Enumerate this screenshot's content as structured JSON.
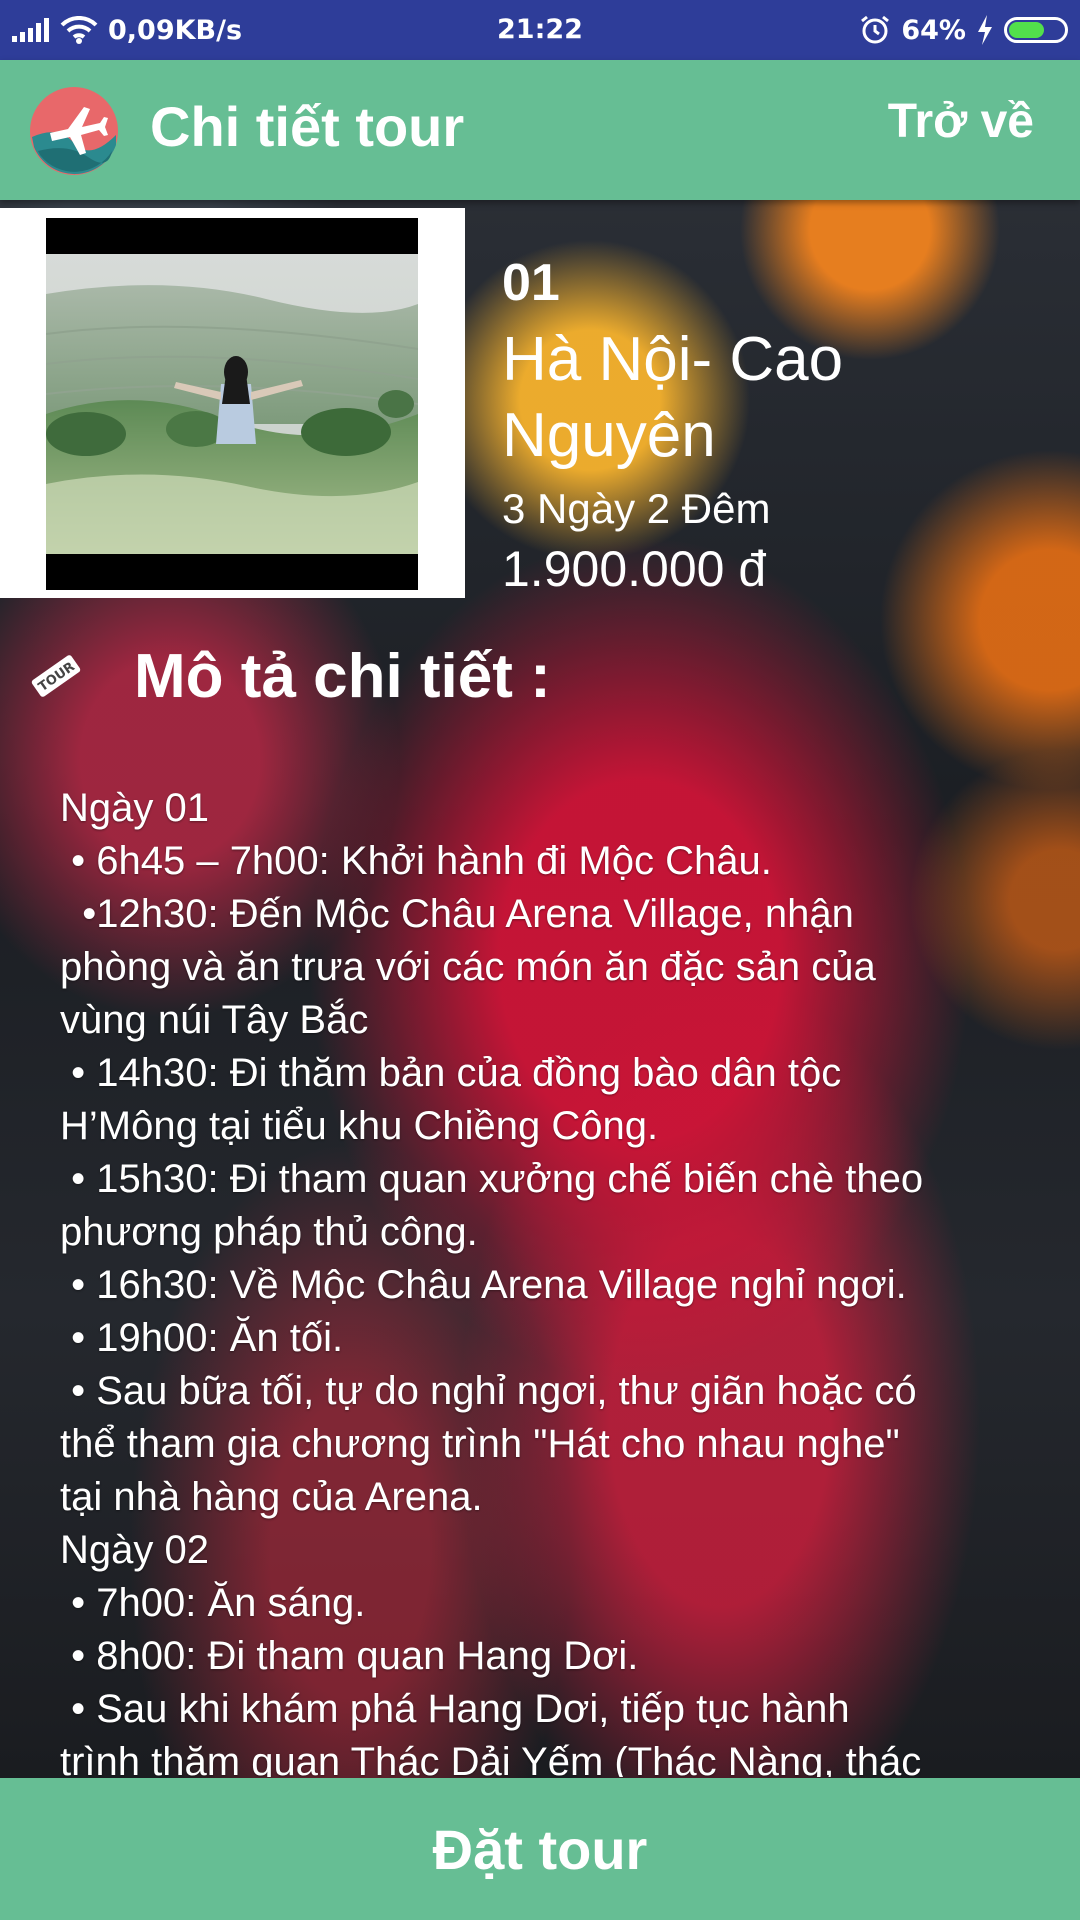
{
  "status_bar": {
    "network_speed": "0,09KB/s",
    "time": "21:22",
    "battery_percent": "64%",
    "battery_level": 0.64,
    "icons": [
      "signal-icon",
      "wifi-icon",
      "alarm-icon",
      "charging-icon",
      "battery-icon"
    ]
  },
  "app_bar": {
    "title": "Chi tiết tour",
    "back_label": "Trở về",
    "logo_icon": "airplane-globe-icon"
  },
  "tour": {
    "id": "01",
    "name_line1": "Hà Nội- Cao",
    "name_line2": "Nguyên",
    "duration": "3 Ngày 2 Đêm",
    "price": "1.900.000 đ"
  },
  "description": {
    "title": "Mô tả chi tiết :",
    "icon": "tour-tag-icon",
    "lines": [
      "Ngày 01",
      " • 6h45 – 7h00: Khởi hành đi Mộc Châu.",
      "  •12h30: Đến Mộc Châu Arena Village, nhận",
      "phòng và ăn trưa với các món ăn đặc sản của",
      "vùng núi Tây Bắc",
      " • 14h30: Đi thăm bản của đồng bào dân tộc",
      "H’Mông tại tiểu khu Chiềng Công.",
      " • 15h30: Đi tham quan xưởng chế biến chè theo",
      "phương pháp thủ công.",
      " • 16h30: Về Mộc Châu Arena Village nghỉ ngơi.",
      " • 19h00: Ăn tối.",
      " • Sau bữa tối, tự do nghỉ ngơi, thư giãn hoặc có",
      "thể tham gia chương trình \"Hát cho nhau nghe\"",
      "tại nhà hàng của Arena.",
      "Ngày 02",
      " • 7h00: Ăn sáng.",
      " • 8h00: Đi tham quan Hang Dơi.",
      " • Sau khi khám phá Hang Dơi, tiếp tục hành",
      "trình thăm quan Thác Dải Yếm (Thác Nàng, thác"
    ]
  },
  "book_button": {
    "label": "Đặt tour"
  },
  "colors": {
    "status_bar": "#2e3d99",
    "accent": "#66be94",
    "battery": "#52e04b"
  }
}
